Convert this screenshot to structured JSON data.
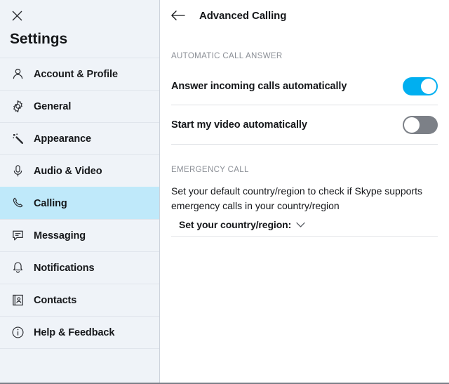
{
  "sidebar": {
    "close_icon": "close-icon",
    "title": "Settings",
    "items": [
      {
        "label": "Account & Profile",
        "icon": "person-icon",
        "selected": false
      },
      {
        "label": "General",
        "icon": "gear-icon",
        "selected": false
      },
      {
        "label": "Appearance",
        "icon": "magic-wand-icon",
        "selected": false
      },
      {
        "label": "Audio & Video",
        "icon": "microphone-icon",
        "selected": false
      },
      {
        "label": "Calling",
        "icon": "phone-icon",
        "selected": true
      },
      {
        "label": "Messaging",
        "icon": "chat-bubble-icon",
        "selected": false
      },
      {
        "label": "Notifications",
        "icon": "bell-icon",
        "selected": false
      },
      {
        "label": "Contacts",
        "icon": "contact-card-icon",
        "selected": false
      },
      {
        "label": "Help & Feedback",
        "icon": "info-circle-icon",
        "selected": false
      }
    ]
  },
  "main": {
    "back_icon": "back-arrow-icon",
    "title": "Advanced Calling",
    "sections": [
      {
        "label": "AUTOMATIC CALL ANSWER",
        "rows": [
          {
            "label": "Answer incoming calls automatically",
            "toggle": "on"
          },
          {
            "label": "Start my video automatically",
            "toggle": "off"
          }
        ]
      },
      {
        "label": "EMERGENCY CALL",
        "description": "Set your default country/region to check if Skype supports emergency calls in your country/region",
        "country_label": "Set your country/region:",
        "chevron_icon": "chevron-down-icon"
      }
    ]
  },
  "colors": {
    "accent_on": "#00aff0",
    "toggle_off": "#7c8087",
    "sidebar_bg": "#eff3f8",
    "selected_bg": "#bfe9fa",
    "text": "#15171a",
    "muted": "#8b8f96"
  }
}
